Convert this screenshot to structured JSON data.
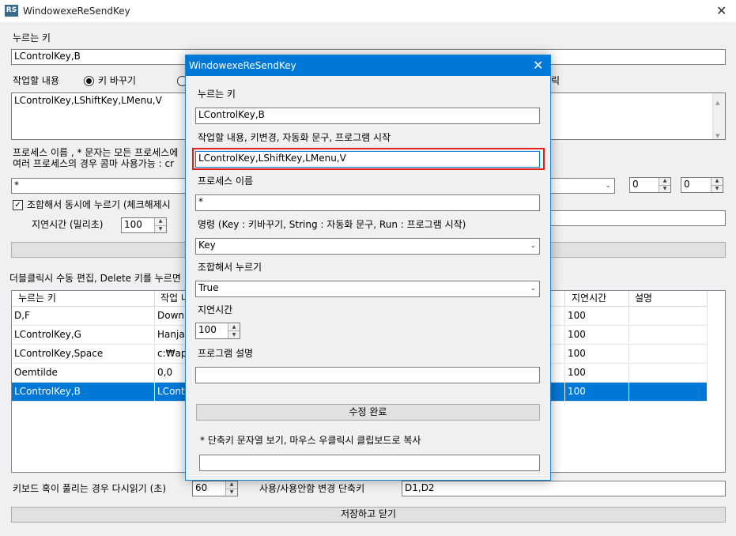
{
  "window": {
    "title": "WindowexeReSendKey",
    "icon_label": "RS",
    "close_glyph": "✕"
  },
  "main": {
    "press_key_label": "누르는 키",
    "press_key_value": "LControlKey,B",
    "task_label": "작업할 내용",
    "radio_key_change_label": "키 바꾸기",
    "radio_right_partial": "릭",
    "task_text": "LControlKey,LShiftKey,LMenu,V",
    "process_label_line1": "프로세스 이름 , * 문자는 모든 프로세스에",
    "process_label_line2": "여러 프로세스의 경우 콤마 사용가능 : cr",
    "process_value": "*",
    "spin_a": "0",
    "spin_b": "0",
    "combine_check_label": "조합해서 동시에 누르기 (체크해제시",
    "delay_label": "지연시간 (밀리초)",
    "delay_value": "100",
    "grid_caption": "더블클릭시 수동 편집, Delete 키를 누르면",
    "reload_label": "키보드 혹이 풀리는 경우 다시읽기 (초)",
    "reload_value": "60",
    "toggle_shortcut_label": "사용/사용안함 변경 단축키",
    "toggle_shortcut_value": "D1,D2",
    "save_close_button": "저장하고 닫기"
  },
  "grid": {
    "columns": [
      "누르는 키",
      "작업 내",
      "지연시간",
      "설명"
    ],
    "rows": [
      {
        "key": "D,F",
        "task": "Down",
        "delay": "100",
        "desc": ""
      },
      {
        "key": "LControlKey,G",
        "task": "HanjaM",
        "delay": "100",
        "desc": ""
      },
      {
        "key": "LControlKey,Space",
        "task": "c:₩ap",
        "delay": "100",
        "desc": ""
      },
      {
        "key": "Oemtilde",
        "task": "0,0",
        "delay": "100",
        "desc": ""
      },
      {
        "key": "LControlKey,B",
        "task": "LContr",
        "delay": "100",
        "desc": ""
      }
    ],
    "selected_row": 4
  },
  "dialog": {
    "title": "WindowexeReSendKey",
    "close_glyph": "✕",
    "press_key_label": "누르는 키",
    "press_key_value": "LControlKey,B",
    "task_label": "작업할 내용, 키변경, 자동화 문구, 프로그램 시작",
    "task_value": "LControlKey,LShiftKey,LMenu,V",
    "process_label": "프로세스 이름",
    "process_value": "*",
    "command_label": "명령 (Key : 키바꾸기, String : 자동화 문구, Run : 프로그램 시작)",
    "command_value": "Key",
    "combine_label": "조합해서 누르기",
    "combine_value": "True",
    "delay_label": "지연시간",
    "delay_value": "100",
    "desc_label": "프로그램 설명",
    "desc_value": "",
    "done_button": "수정 완료",
    "note": "* 단축키 문자열 보기, 마우스 우클릭시 클립보드로 복사",
    "note_value": "",
    "highlight_color": "#e0201c"
  }
}
